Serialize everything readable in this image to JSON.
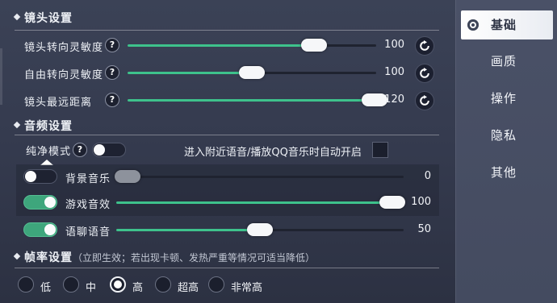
{
  "sidebar": {
    "items": [
      {
        "label": "基础",
        "active": true
      },
      {
        "label": "画质"
      },
      {
        "label": "操作"
      },
      {
        "label": "隐私"
      },
      {
        "label": "其他"
      }
    ]
  },
  "camera": {
    "title": "镜头设置",
    "rows": [
      {
        "label": "镜头转向灵敏度",
        "value": "100",
        "level": 0.75
      },
      {
        "label": "自由转向灵敏度",
        "value": "100",
        "level": 0.5
      },
      {
        "label": "镜头最远距离",
        "value": "120",
        "level": 1.0
      }
    ],
    "help_symbol": "?"
  },
  "audio": {
    "title": "音频设置",
    "pure_mode_label": "纯净模式",
    "pure_mode_on": false,
    "auto_start_label": "进入附近语音/播放QQ音乐时自动开启",
    "auto_start_checked": false,
    "rows": [
      {
        "label": "背景音乐",
        "value": "0",
        "on": false,
        "level": 0.0
      },
      {
        "label": "游戏音效",
        "value": "100",
        "on": true,
        "level": 1.0
      },
      {
        "label": "语聊语音",
        "value": "50",
        "on": true,
        "level": 0.5
      }
    ]
  },
  "framerate": {
    "title": "帧率设置",
    "subtitle": "（立即生效；若出现卡顿、发热严重等情况可适当降低）",
    "options": [
      {
        "label": "低",
        "selected": false
      },
      {
        "label": "中",
        "selected": false
      },
      {
        "label": "高",
        "selected": true
      },
      {
        "label": "超高",
        "selected": false
      },
      {
        "label": "非常高",
        "selected": false
      }
    ]
  },
  "colors": {
    "accent": "#3ec28c",
    "toggle_on": "#3ea67c"
  },
  "icons": {
    "reset": "reset-icon",
    "help": "help-icon",
    "section": "diamond-icon"
  }
}
